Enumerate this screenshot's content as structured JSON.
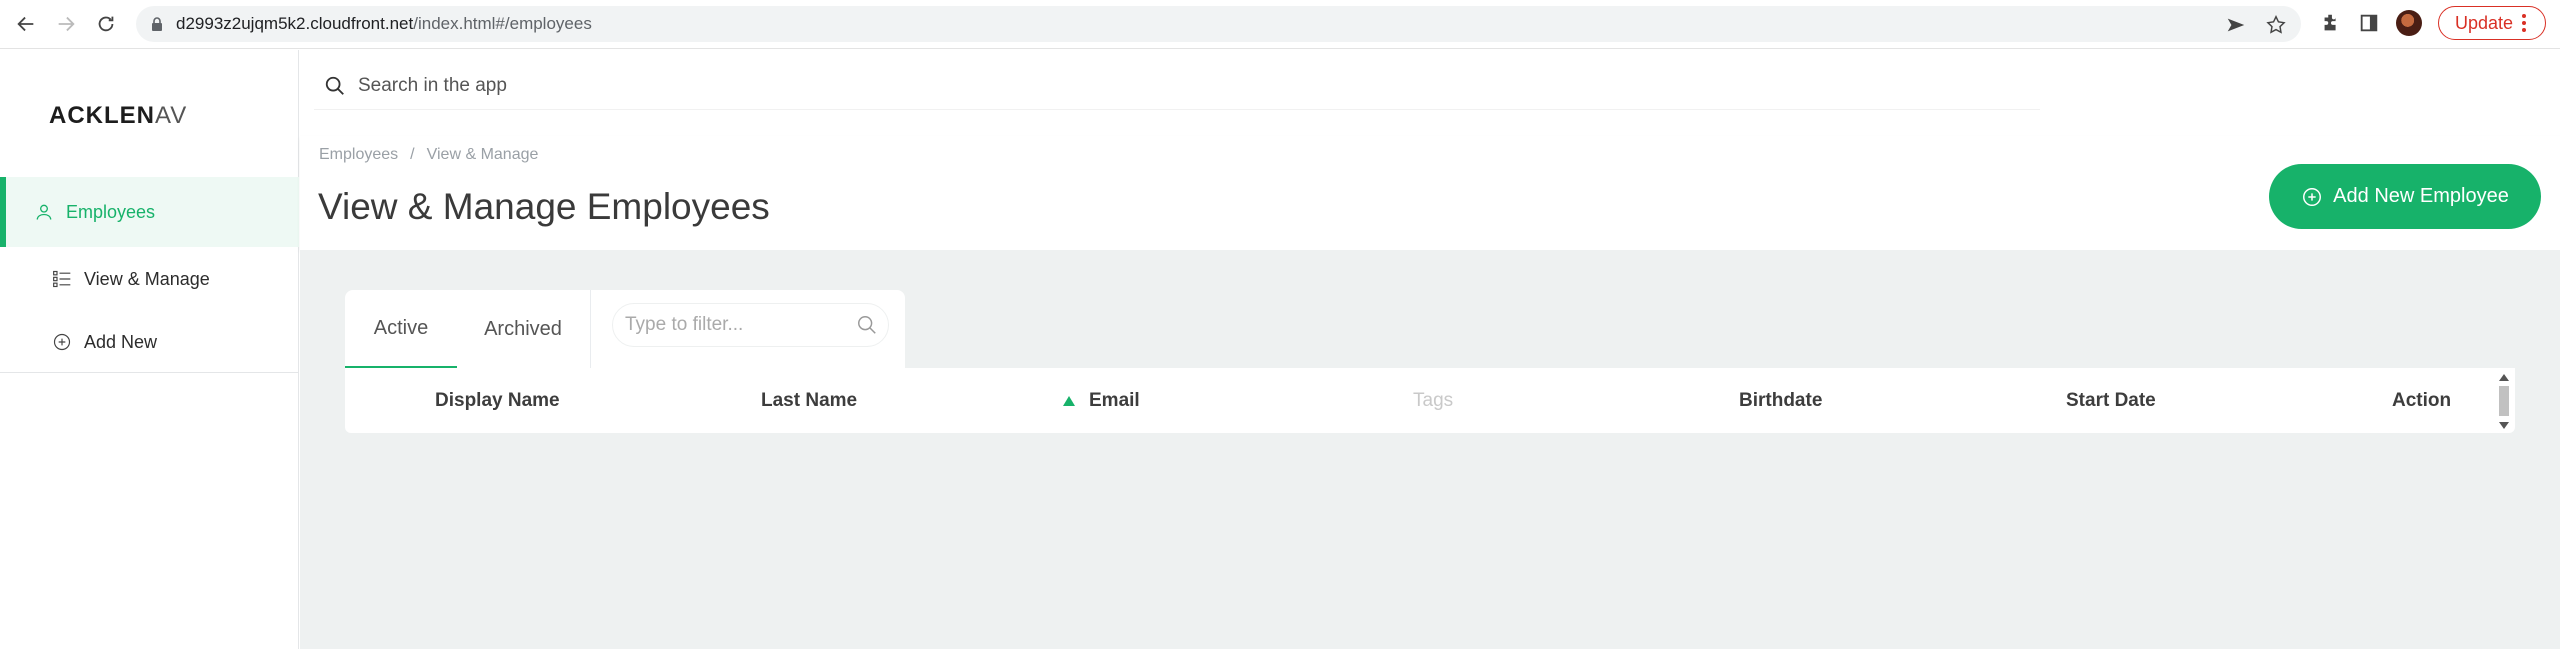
{
  "browser": {
    "url_host": "d2993z2ujqm5k2.cloudfront.net",
    "url_path": "/index.html#/employees",
    "update_label": "Update"
  },
  "sidebar": {
    "logo_bold": "ACKLEN",
    "logo_light": "AV",
    "items": [
      {
        "label": "Employees",
        "icon": "user-icon",
        "active": true
      },
      {
        "label": "View & Manage",
        "icon": "list-icon",
        "active": false
      },
      {
        "label": "Add New",
        "icon": "plus-circle-icon",
        "active": false
      }
    ]
  },
  "search": {
    "placeholder": "Search in the app"
  },
  "header": {
    "breadcrumbs": [
      "Employees",
      "View & Manage"
    ],
    "breadcrumb_separator": "/",
    "title": "View & Manage Employees",
    "add_button_label": "Add New Employee"
  },
  "tabs": [
    {
      "label": "Active",
      "active": true
    },
    {
      "label": "Archived",
      "active": false
    }
  ],
  "filter": {
    "placeholder": "Type to filter..."
  },
  "table": {
    "columns": [
      {
        "label": "Display Name",
        "sorted": false,
        "muted": false
      },
      {
        "label": "Last Name",
        "sorted": false,
        "muted": false
      },
      {
        "label": "Email",
        "sorted": true,
        "muted": false
      },
      {
        "label": "Tags",
        "sorted": false,
        "muted": true
      },
      {
        "label": "Birthdate",
        "sorted": false,
        "muted": false
      },
      {
        "label": "Start Date",
        "sorted": false,
        "muted": false
      },
      {
        "label": "Action",
        "sorted": false,
        "muted": false
      }
    ]
  },
  "colors": {
    "accent": "#17b26a",
    "main_bg": "#eef1f1",
    "update_red": "#d93025"
  }
}
